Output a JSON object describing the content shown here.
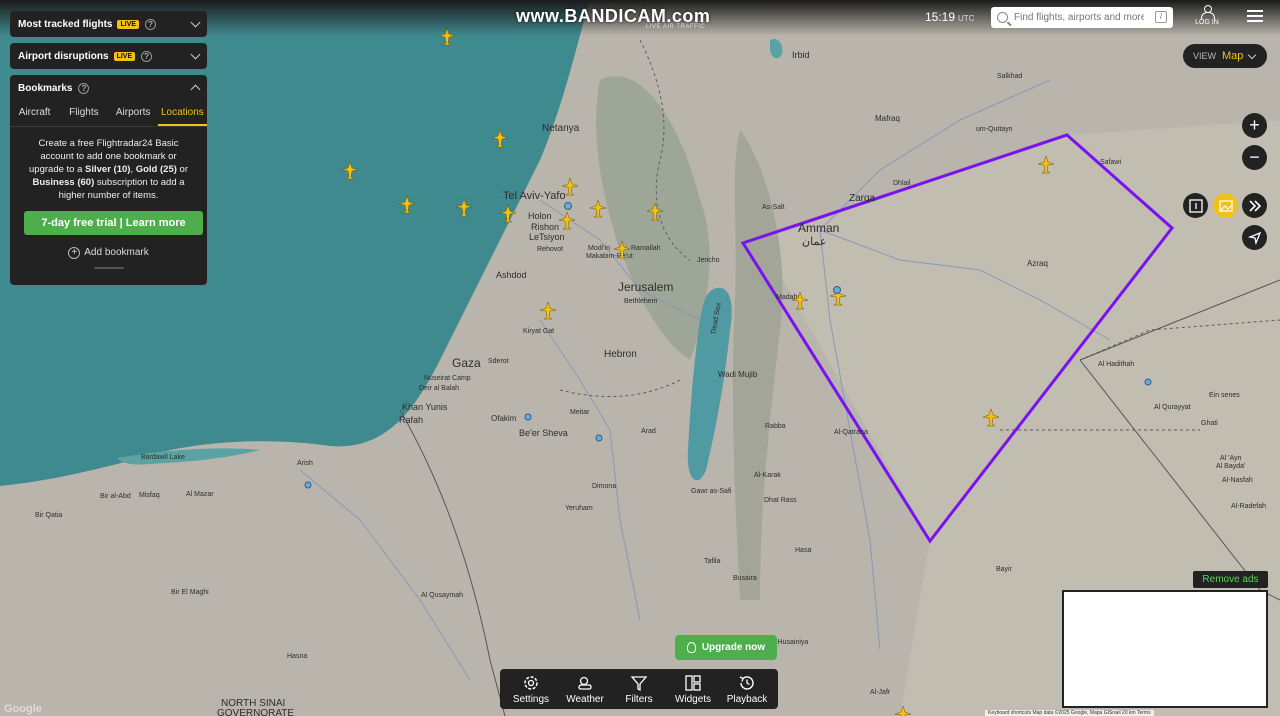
{
  "watermark": {
    "brand": "www.BANDICAM.com",
    "sub": "LIVE AIR TRAFFIC"
  },
  "header": {
    "time": "15:19",
    "timezone": "UTC",
    "search_placeholder": "Find flights, airports and more",
    "search_shortcut": "/",
    "login_label": "LOG IN"
  },
  "panels": {
    "tracked": {
      "title": "Most tracked flights",
      "badge": "LIVE"
    },
    "disruptions": {
      "title": "Airport disruptions",
      "badge": "LIVE"
    },
    "bookmarks": {
      "title": "Bookmarks",
      "tabs": [
        "Aircraft",
        "Flights",
        "Airports",
        "Locations"
      ],
      "active_tab": "Locations",
      "text_before": "Create a free Flightradar24 Basic account to add one bookmark or upgrade to a ",
      "silver": "Silver (10)",
      "sep1": ", ",
      "gold": "Gold (25)",
      "sep2": " or ",
      "business": "Business (60)",
      "text_after": " subscription to add a higher number of items.",
      "trial_button": "7-day free trial | Learn more",
      "add_bookmark": "Add bookmark"
    }
  },
  "view": {
    "label": "VIEW",
    "value": "Map"
  },
  "controls": {
    "zoom_in": "+",
    "zoom_out": "−"
  },
  "remove_ads": "Remove ads",
  "upgrade_button": "Upgrade now",
  "toolbar": {
    "items": [
      "Settings",
      "Weather",
      "Filters",
      "Widgets",
      "Playback"
    ]
  },
  "map": {
    "colors": {
      "sea": "#3f8a8f",
      "land": "#b9b5ac",
      "highlight": "#7a12f0",
      "aircraft": "#f2c018"
    },
    "labels": {
      "netanya": "Netanya",
      "telaviv": "Tel Aviv-Yafo",
      "holon": "Holon",
      "rishon": "Rishon",
      "letsiyon": "LeTsiyon",
      "rehovot": "Rehovot",
      "modiin": "Modi'in",
      "makabim": "Makabim-Re'ut",
      "ramallah": "Ramallah",
      "ashdod": "Ashdod",
      "jerusalem": "Jerusalem",
      "bethlehem": "Bethlehem",
      "kiryatgat": "Kiryat Gat",
      "hebron": "Hebron",
      "gaza": "Gaza",
      "sderot": "Sderot",
      "nuseirat": "Nuseirat Camp",
      "deiralbalah": "Deir al Balah",
      "khanyunis": "Khan Yunis",
      "rafah": "Rafah",
      "ofakim": "Ofakim",
      "meitar": "Meitar",
      "beersheva": "Be'er Sheva",
      "arad": "Arad",
      "dimona": "Dimona",
      "yeruham": "Yeruham",
      "bardawil": "Bardawil Lake",
      "arish": "Arish",
      "alabd": "Bir al-Abd",
      "misfaq": "Misfaq",
      "almazar": "Al Mazar",
      "birqatia": "Bir Qatia",
      "birelmaghi": "Bir El Maghi",
      "alqusaymah": "Al Qusaymah",
      "hasna": "Hasna",
      "northsinai1": "NORTH SINAI",
      "northsinai2": "GOVERNORATE",
      "irbid": "Irbid",
      "mafraq": "Mafraq",
      "ummqutten": "um-Quttayn",
      "salkhad": "Salkhad",
      "safawi": "Safawi",
      "zarqa": "Zarqa",
      "dhlail": "Dhlail",
      "assalt": "As-Salt",
      "amman": "Amman",
      "amman_ar": "عمان",
      "jericho": "Jericho",
      "azraq": "Azraq",
      "madaba": "Madaba",
      "wadimujib": "Wadi Mujib",
      "aqatrana": "Al-Qatrana",
      "rabba": "Rabba",
      "almkarak": "Al-Karak",
      "gawr": "Gawr as-Safi",
      "dhatrass": "Dhat Rass",
      "hasa": "Hasa",
      "tafila": "Tafila",
      "busaira": "Busaira",
      "alhusainiya": "Al-Husainiya",
      "bayir": "Bayir",
      "aljafr": "Al-Jafr",
      "alhaditha": "Al Hadithah",
      "alqurayyat": "Al Qurayyat",
      "einsenes": "Ein senes",
      "ghati": "Ghati",
      "alayn": "Al 'Ayn",
      "albayda": "Al Bayda'",
      "alnasfah": "Al-Nasfah",
      "alradefah": "Al-Radefah",
      "deadsea": "Dead Sea",
      "google": "Google",
      "attrib": "Keyboard shortcuts   Map data ©2025 Google, Mapa GISrael   20 km   Terms"
    }
  }
}
